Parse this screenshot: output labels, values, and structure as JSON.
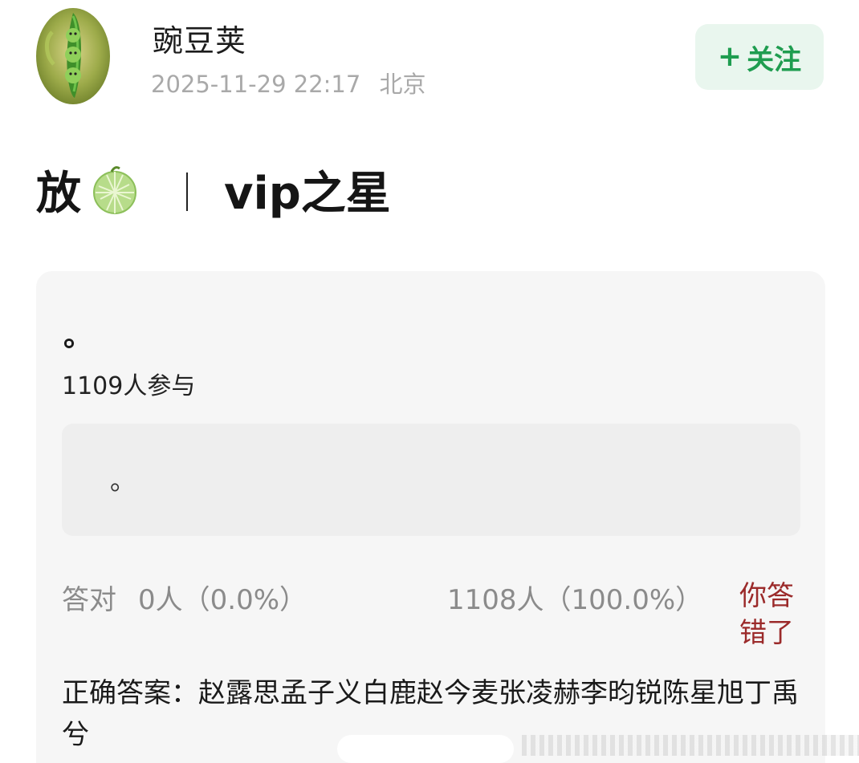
{
  "post": {
    "author": "豌豆荚",
    "timestamp": "2025-11-29 22:17",
    "location": "北京",
    "follow_label": "关注",
    "follow_plus": "+",
    "title_prefix": "放",
    "title_emoji": "melon-emoji",
    "title_separator": "｜",
    "title_suffix": "vip之星"
  },
  "quiz": {
    "question": "。",
    "participants": "1109人参与",
    "option": "。",
    "correct_label": "答对",
    "correct_stat": "0人（0.0%）",
    "wrong_stat": "1108人（100.0%）",
    "verdict": "你答错了",
    "answer": "正确答案：赵露思孟子义白鹿赵今麦张凌赫李昀锐陈星旭丁禹兮"
  },
  "colors": {
    "follow_bg": "#e9f6ee",
    "follow_text": "#1f9d50",
    "verdict_red": "#9b2a2a",
    "card_bg": "#f6f6f6"
  },
  "icons": [
    "pea-avatar",
    "melon-emoji"
  ]
}
